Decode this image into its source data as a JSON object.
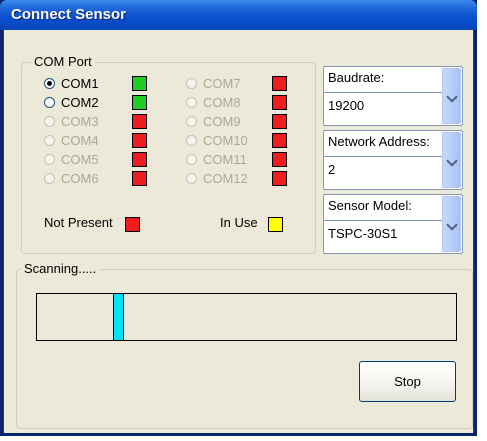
{
  "window": {
    "title": "Connect Sensor"
  },
  "com_port": {
    "label": "COM Port",
    "ports": [
      {
        "label": "COM1",
        "enabled": true,
        "selected": true,
        "status": "green"
      },
      {
        "label": "COM2",
        "enabled": true,
        "selected": false,
        "status": "green"
      },
      {
        "label": "COM3",
        "enabled": false,
        "selected": false,
        "status": "red"
      },
      {
        "label": "COM4",
        "enabled": false,
        "selected": false,
        "status": "red"
      },
      {
        "label": "COM5",
        "enabled": false,
        "selected": false,
        "status": "red"
      },
      {
        "label": "COM6",
        "enabled": false,
        "selected": false,
        "status": "red"
      },
      {
        "label": "COM7",
        "enabled": false,
        "selected": false,
        "status": "red"
      },
      {
        "label": "COM8",
        "enabled": false,
        "selected": false,
        "status": "red"
      },
      {
        "label": "COM9",
        "enabled": false,
        "selected": false,
        "status": "red"
      },
      {
        "label": "COM10",
        "enabled": false,
        "selected": false,
        "status": "red"
      },
      {
        "label": "COM11",
        "enabled": false,
        "selected": false,
        "status": "red"
      },
      {
        "label": "COM12",
        "enabled": false,
        "selected": false,
        "status": "red"
      }
    ],
    "legend": {
      "not_present": "Not Present",
      "in_use": "In Use"
    }
  },
  "colors": {
    "green": "#22cc22",
    "red": "#ee1c1c",
    "yellow": "#ffff00",
    "progress": "#00e4ff"
  },
  "baudrate": {
    "label": "Baudrate:",
    "value": "19200"
  },
  "network_address": {
    "label": "Network Address:",
    "value": "2"
  },
  "sensor_model": {
    "label": "Sensor Model:",
    "value": "TSPC-30S1"
  },
  "scanning": {
    "label": "Scanning.....",
    "progress": 0.18
  },
  "stop_button": {
    "label": "Stop"
  }
}
